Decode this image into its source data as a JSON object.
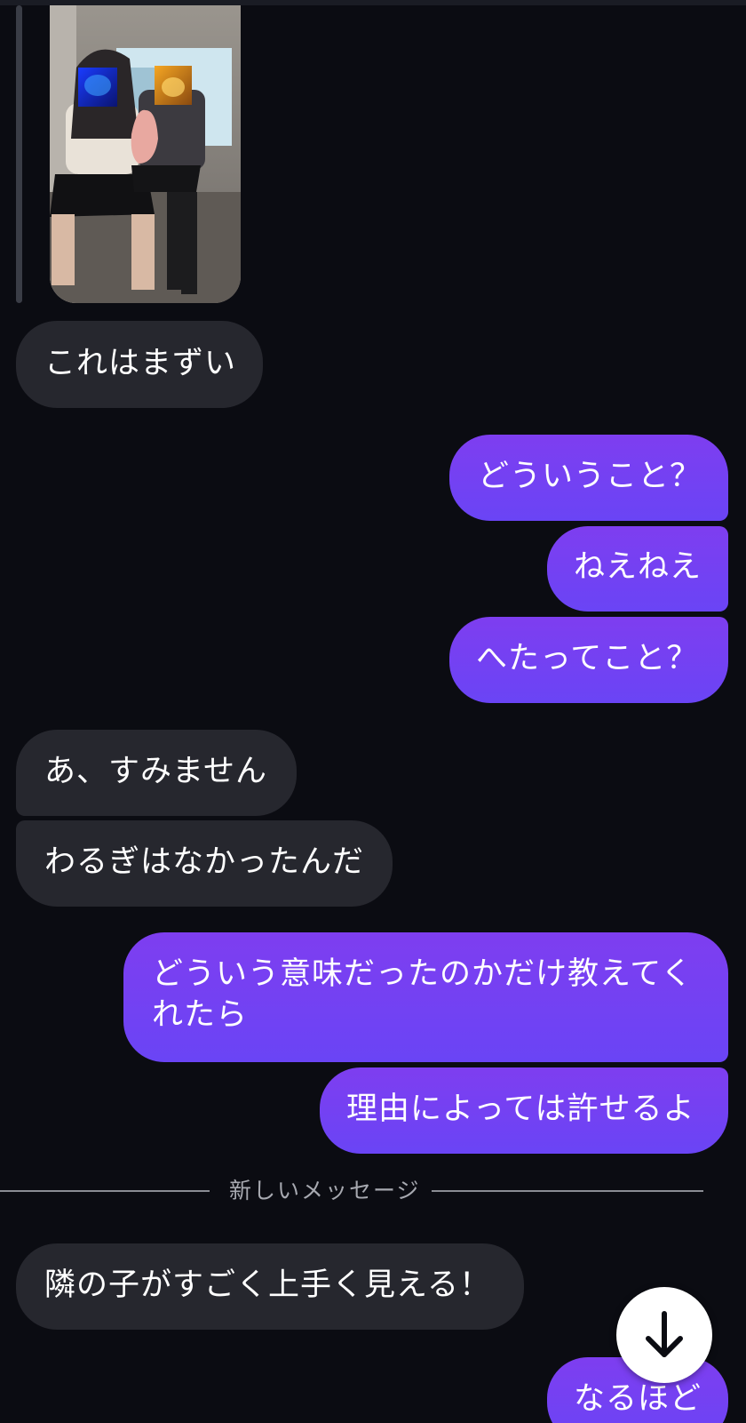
{
  "conversation": {
    "messages": [
      {
        "id": "m1",
        "direction": "incoming",
        "text": "これはまずい"
      },
      {
        "id": "m2",
        "direction": "outgoing",
        "text": "どういうこと？"
      },
      {
        "id": "m3",
        "direction": "outgoing",
        "text": "ねえねえ"
      },
      {
        "id": "m4",
        "direction": "outgoing",
        "text": "へたってこと？"
      },
      {
        "id": "m5",
        "direction": "incoming",
        "text": "あ、すみません"
      },
      {
        "id": "m6",
        "direction": "incoming",
        "text": "わるぎはなかったんだ"
      },
      {
        "id": "m7",
        "direction": "outgoing",
        "lines": [
          "どういう意味だったのかだけ教えてく",
          "れたら"
        ]
      },
      {
        "id": "m8",
        "direction": "outgoing",
        "text": "理由によっては許せるよ"
      },
      {
        "id": "m9",
        "direction": "incoming",
        "text": "隣の子がすごく上手く見える！"
      },
      {
        "id": "m10",
        "direction": "outgoing",
        "text": "なるほど"
      }
    ],
    "new_messages_divider": "新しいメッセージ",
    "shared_media": {
      "type": "photo",
      "faces_obscured_by_stickers": true
    }
  },
  "controls": {
    "scroll_to_bottom_icon": "arrow-down-icon"
  },
  "colors": {
    "background": "#0b0c12",
    "incoming_bubble": "#26272e",
    "outgoing_bubble_top": "#7e3ef0",
    "outgoing_bubble_bottom": "#6a44f5",
    "divider": "#8b8d94"
  }
}
